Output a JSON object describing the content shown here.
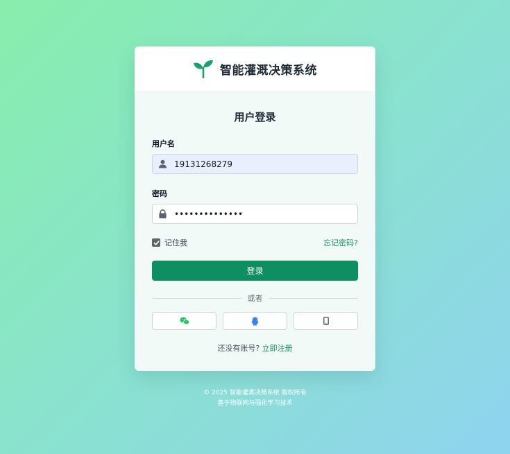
{
  "app": {
    "title": "智能灌溉决策系统",
    "logo_icon": "seedling-icon"
  },
  "login": {
    "heading": "用户登录",
    "username_label": "用户名",
    "username_value": "19131268279",
    "username_icon": "user-icon",
    "password_label": "密码",
    "password_value": "••••••••••••••",
    "password_icon": "lock-icon",
    "remember_label": "记住我",
    "remember_checked": true,
    "forgot_link": "忘记密码?",
    "submit_label": "登录"
  },
  "divider": {
    "text": "或者"
  },
  "social": [
    {
      "icon": "wechat-icon",
      "color": "#22c55e"
    },
    {
      "icon": "qq-icon",
      "color": "#3b82f6"
    },
    {
      "icon": "mobile-phone-icon",
      "color": "#4b5563"
    }
  ],
  "register": {
    "prompt": "还没有账号?",
    "link": "立即注册"
  },
  "footer": {
    "copyright": "© 2025 智能灌溉决策系统 版权所有",
    "tagline": "基于物联网与强化学习技术"
  },
  "colors": {
    "primary": "#0d8f61",
    "link": "#13905f"
  }
}
